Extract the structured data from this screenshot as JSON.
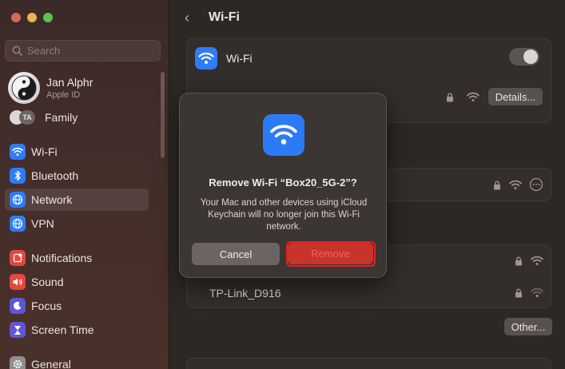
{
  "sidebar": {
    "search_placeholder": "Search",
    "profile": {
      "name": "Jan Alphr",
      "subtitle": "Apple ID"
    },
    "family": {
      "initials": "TA",
      "label": "Family"
    },
    "items": [
      {
        "label": "Wi-Fi",
        "icon": "wifi-icon",
        "color": "#2f7cf6"
      },
      {
        "label": "Bluetooth",
        "icon": "bluetooth-icon",
        "color": "#2f7cf6"
      },
      {
        "label": "Network",
        "icon": "globe-icon",
        "color": "#2f7cf6",
        "selected": true
      },
      {
        "label": "VPN",
        "icon": "globe-icon",
        "color": "#2f7cf6"
      },
      {
        "label": "Notifications",
        "icon": "bell-icon",
        "color": "#e3493f"
      },
      {
        "label": "Sound",
        "icon": "speaker-icon",
        "color": "#e3493f"
      },
      {
        "label": "Focus",
        "icon": "moon-icon",
        "color": "#5f56d6"
      },
      {
        "label": "Screen Time",
        "icon": "hourglass-icon",
        "color": "#5f56d6"
      },
      {
        "label": "General",
        "icon": "gear-icon",
        "color": "#8e8e93"
      }
    ]
  },
  "main": {
    "title": "Wi-Fi",
    "wifi_row_label": "Wi-Fi",
    "details_label": "Details...",
    "known_networks": [
      {
        "name": "TP-Link_D916"
      }
    ],
    "other_label": "Other..."
  },
  "dialog": {
    "title": "Remove Wi-Fi “Box20_5G-2”?",
    "message": "Your Mac and other devices using iCloud Keychain will no longer join this Wi-Fi network.",
    "cancel_label": "Cancel",
    "remove_label": "Remove"
  },
  "colors": {
    "accent": "#2f7cf6",
    "highlight_border": "#e32025",
    "destructive": "#c8332a"
  }
}
